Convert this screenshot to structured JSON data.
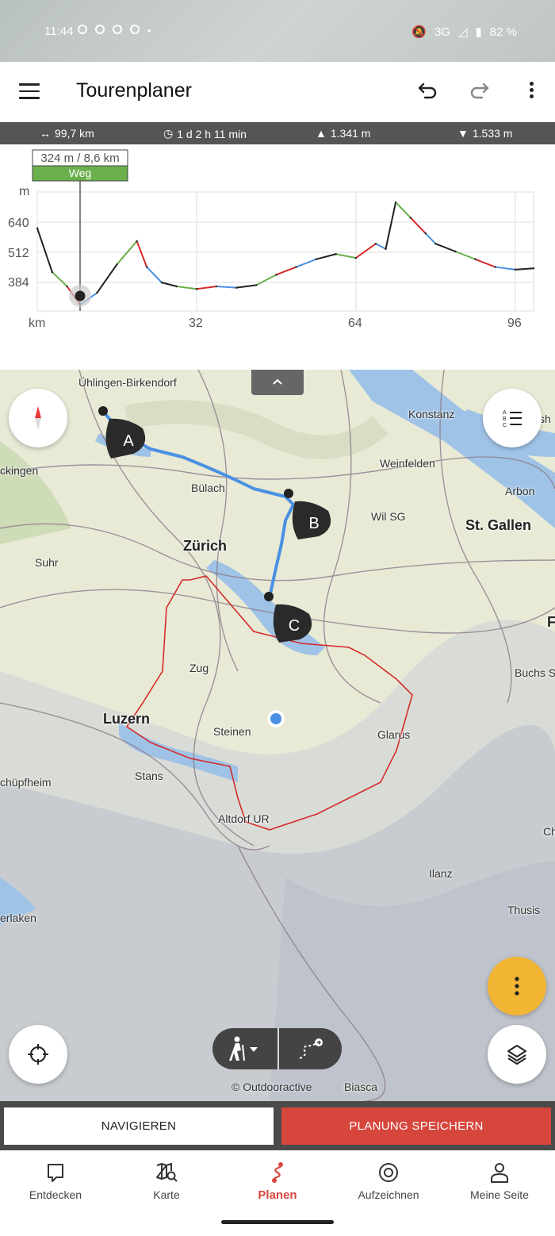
{
  "status_bar": {
    "time": "11:44",
    "network": "3G",
    "battery": "82 %"
  },
  "app_bar": {
    "title": "Tourenplaner"
  },
  "stats": {
    "distance": "99,7 km",
    "duration": "1 d 2 h 11 min",
    "ascent": "1.341 m",
    "descent": "1.533 m"
  },
  "elevation_chart": {
    "tooltip_value": "324 m / 8,6 km",
    "tooltip_surface": "Weg",
    "y_unit": "m",
    "x_unit": "km",
    "y_ticks": [
      "640",
      "512",
      "384"
    ],
    "x_ticks": [
      "32",
      "64",
      "96"
    ],
    "surface_color": "#6ab04c",
    "line_color": "#222222"
  },
  "chart_data": {
    "type": "line",
    "x": [
      0,
      3,
      6,
      8.6,
      12,
      16,
      20,
      22,
      25,
      28,
      32,
      36,
      40,
      44,
      48,
      52,
      56,
      60,
      64,
      68,
      70,
      72,
      75,
      78,
      80,
      84,
      88,
      92,
      96,
      99.7
    ],
    "y": [
      620,
      450,
      395,
      324,
      370,
      480,
      570,
      470,
      410,
      395,
      385,
      395,
      390,
      400,
      440,
      470,
      500,
      520,
      505,
      560,
      540,
      720,
      660,
      600,
      560,
      530,
      500,
      470,
      460,
      465
    ],
    "xlabel": "km",
    "ylabel": "m",
    "ylim": [
      300,
      760
    ],
    "xlim": [
      0,
      99.7
    ]
  },
  "map": {
    "labels": {
      "uhlingen": "Ühlingen-Birkendorf",
      "konstanz": "Konstanz",
      "weinfelden": "Weinfelden",
      "arbon": "Arbon",
      "kingen": "ckingen",
      "bulach": "Bülach",
      "wil": "Wil SG",
      "stgallen": "St. Gallen",
      "zurich": "Zürich",
      "suhr": "Suhr",
      "zug": "Zug",
      "buchs": "Buchs S",
      "luzern": "Luzern",
      "steinen": "Steinen",
      "glarus": "Glarus",
      "chupfheim": "chüpfheim",
      "stans": "Stans",
      "altdorf": "Altdorf UR",
      "ilanz": "Ilanz",
      "thusis": "Thusis",
      "erlaken": "erlaken",
      "biasca": "Biasca",
      "f": "F",
      "ch": "Ch",
      "sh": "sh"
    },
    "waypoints": [
      "A",
      "B",
      "C"
    ],
    "copyright": "© Outdooractive",
    "route_color": "#4a90e2",
    "track_color": "#d62b2b"
  },
  "actions": {
    "navigate": "NAVIGIEREN",
    "save": "PLANUNG SPEICHERN"
  },
  "bottom_nav": {
    "items": [
      {
        "label": "Entdecken",
        "icon": "chat-icon"
      },
      {
        "label": "Karte",
        "icon": "map-search-icon"
      },
      {
        "label": "Planen",
        "icon": "route-icon"
      },
      {
        "label": "Aufzeichnen",
        "icon": "record-icon"
      },
      {
        "label": "Meine Seite",
        "icon": "person-icon"
      }
    ],
    "active": "Planen"
  }
}
